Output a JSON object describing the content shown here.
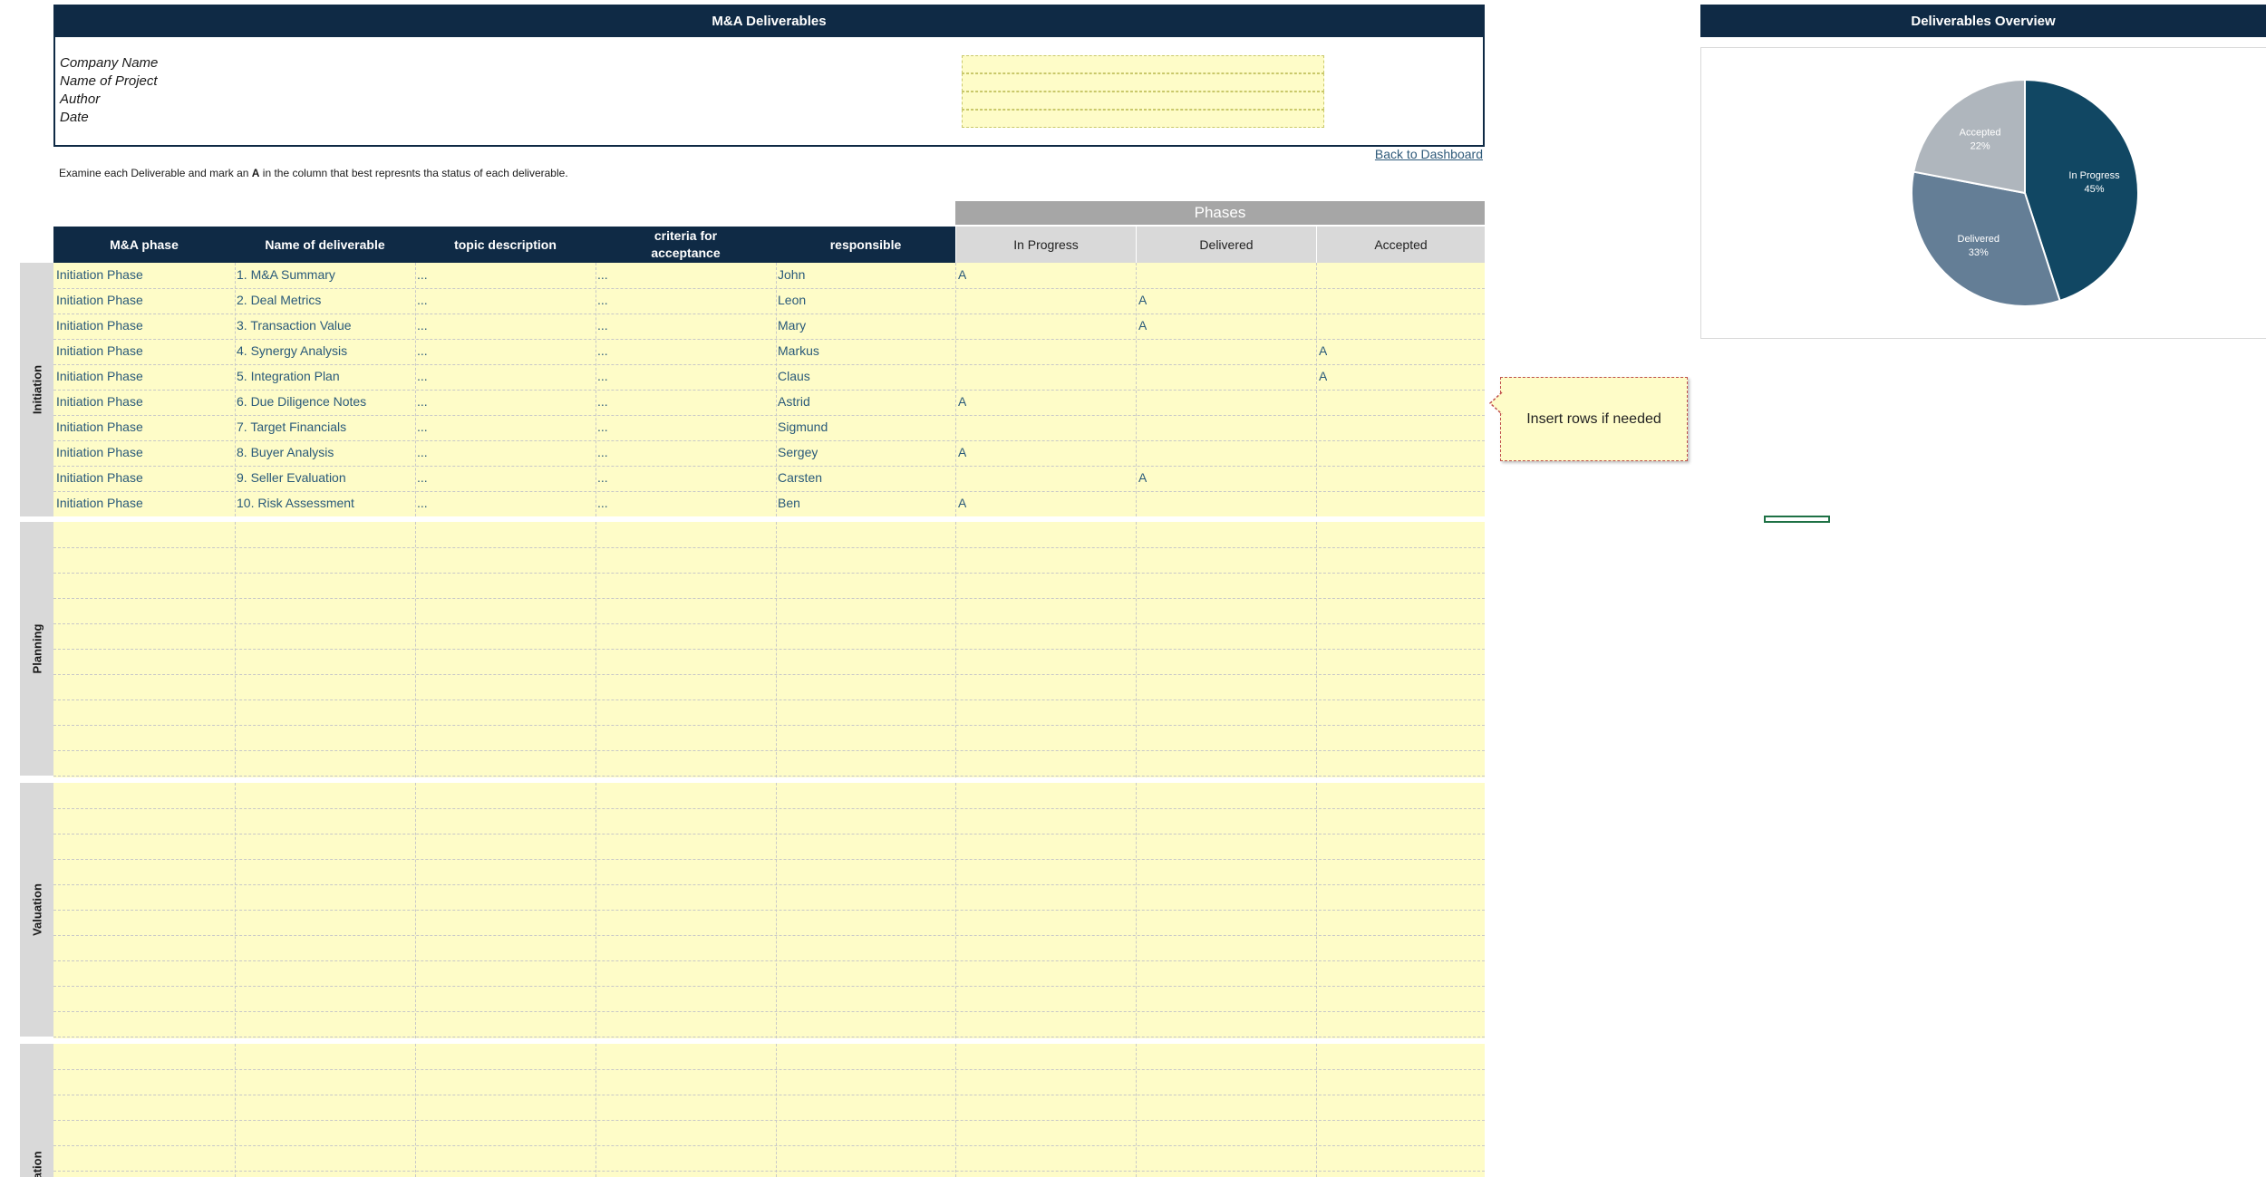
{
  "header": {
    "title": "M&A Deliverables"
  },
  "info": {
    "labels": [
      "Company Name",
      "Name of Project",
      "Author",
      "Date"
    ],
    "values": [
      "",
      "",
      "",
      ""
    ]
  },
  "back_link": "Back to Dashboard",
  "instruction": {
    "before": "Examine each Deliverable and mark an ",
    "mark": "A",
    "after": " in the column that best represnts tha status of each deliverable."
  },
  "phases_label": "Phases",
  "columns": {
    "main": [
      "M&A phase",
      "Name of deliverable",
      "topic description",
      "criteria for acceptance",
      "responsible"
    ],
    "status": [
      "In Progress",
      "Delivered",
      "Accepted"
    ]
  },
  "sections": [
    "Initiation",
    "Planning",
    "Valuation",
    "mentation"
  ],
  "rows": [
    {
      "phase": "Initiation Phase",
      "name": "1. M&A Summary",
      "topic": "...",
      "criteria": "...",
      "responsible": "John",
      "in_progress": "A",
      "delivered": "",
      "accepted": ""
    },
    {
      "phase": "Initiation Phase",
      "name": "2. Deal Metrics",
      "topic": "...",
      "criteria": "...",
      "responsible": "Leon",
      "in_progress": "",
      "delivered": "A",
      "accepted": ""
    },
    {
      "phase": "Initiation Phase",
      "name": "3. Transaction Value",
      "topic": "...",
      "criteria": "...",
      "responsible": "Mary",
      "in_progress": "",
      "delivered": "A",
      "accepted": ""
    },
    {
      "phase": "Initiation Phase",
      "name": "4. Synergy Analysis",
      "topic": "...",
      "criteria": "...",
      "responsible": "Markus",
      "in_progress": "",
      "delivered": "",
      "accepted": "A"
    },
    {
      "phase": "Initiation Phase",
      "name": "5. Integration Plan",
      "topic": "...",
      "criteria": "...",
      "responsible": "Claus",
      "in_progress": "",
      "delivered": "",
      "accepted": "A"
    },
    {
      "phase": "Initiation Phase",
      "name": "6. Due Diligence Notes",
      "topic": "...",
      "criteria": "...",
      "responsible": "Astrid",
      "in_progress": "A",
      "delivered": "",
      "accepted": ""
    },
    {
      "phase": "Initiation Phase",
      "name": "7. Target Financials",
      "topic": "...",
      "criteria": "...",
      "responsible": "Sigmund",
      "in_progress": "",
      "delivered": "",
      "accepted": ""
    },
    {
      "phase": "Initiation Phase",
      "name": "8. Buyer Analysis",
      "topic": "...",
      "criteria": "...",
      "responsible": "Sergey",
      "in_progress": "A",
      "delivered": "",
      "accepted": ""
    },
    {
      "phase": "Initiation Phase",
      "name": "9. Seller Evaluation",
      "topic": "...",
      "criteria": "...",
      "responsible": "Carsten",
      "in_progress": "",
      "delivered": "A",
      "accepted": ""
    },
    {
      "phase": "Initiation Phase",
      "name": "10. Risk Assessment",
      "topic": "...",
      "criteria": "...",
      "responsible": "Ben",
      "in_progress": "A",
      "delivered": "",
      "accepted": ""
    }
  ],
  "callout": "Insert rows if needed",
  "overview": {
    "title": "Deliverables Overview"
  },
  "chart_data": {
    "type": "pie",
    "title": "",
    "slices": [
      {
        "label": "In Progress",
        "value": 45,
        "display": "45%",
        "color": "#114763"
      },
      {
        "label": "Delivered",
        "value": 33,
        "display": "33%",
        "color": "#647e96"
      },
      {
        "label": "Accepted",
        "value": 22,
        "display": "22%",
        "color": "#afb6bd"
      }
    ]
  }
}
